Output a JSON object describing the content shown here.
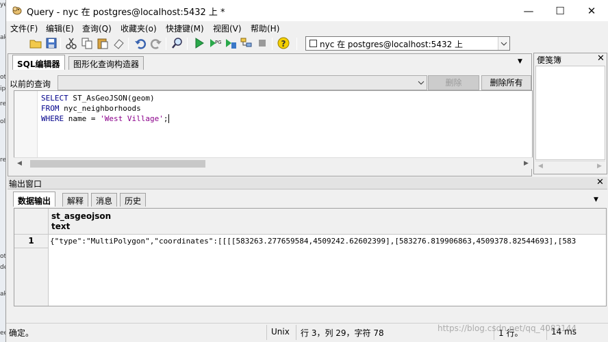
{
  "left_strip": [
    "ye",
    "ak",
    "ot",
    "ip",
    "re",
    "ol",
    "re",
    "ot",
    "de",
    "ak",
    "ee"
  ],
  "window": {
    "title": "Query - nyc 在  postgres@localhost:5432 上 *",
    "minimize": "—",
    "maximize": "☐",
    "close": "✕"
  },
  "menu": [
    "文件(F)",
    "编辑(E)",
    "查询(Q)",
    "收藏夹(o)",
    "快捷键(M)",
    "视图(V)",
    "帮助(H)"
  ],
  "toolbar": {
    "connection": "nyc 在  postgres@localhost:5432 上"
  },
  "sql_panel": {
    "tabs": [
      "SQL编辑器",
      "图形化查询构造器"
    ],
    "dropdown_glyph": "▼",
    "history_label": "以前的查询",
    "delete_button": "删除",
    "delete_all_button": "删除所有",
    "code_lines": [
      {
        "kw": "SELECT",
        "rest": " ST_AsGeoJSON(geom)"
      },
      {
        "kw": "FROM",
        "rest": " nyc_neighborhoods"
      },
      {
        "kw": "WHERE",
        "rest": " name = ",
        "str": "'West Village'",
        "tail": ";"
      }
    ]
  },
  "scratch_pad": {
    "title": "便笺簿",
    "close": "✕"
  },
  "output_panel": {
    "title": "输出窗口",
    "close": "✕",
    "tabs": [
      "数据输出",
      "解释",
      "消息",
      "历史"
    ],
    "dropdown_glyph": "▼",
    "column": {
      "name": "st_asgeojson",
      "type": "text"
    },
    "rows": [
      {
        "num": "1",
        "value": "{\"type\":\"MultiPolygon\",\"coordinates\":[[[[583263.277659584,4509242.62602399],[583276.819906863,4509378.82544693],[583"
      }
    ]
  },
  "statusbar": {
    "status": "确定。",
    "line_ending": "Unix",
    "position": "行 3，列 29，字符 78",
    "rows": "1 行。",
    "time": "14 ms"
  },
  "watermark": "https://blog.csdn.net/qq_4082144"
}
